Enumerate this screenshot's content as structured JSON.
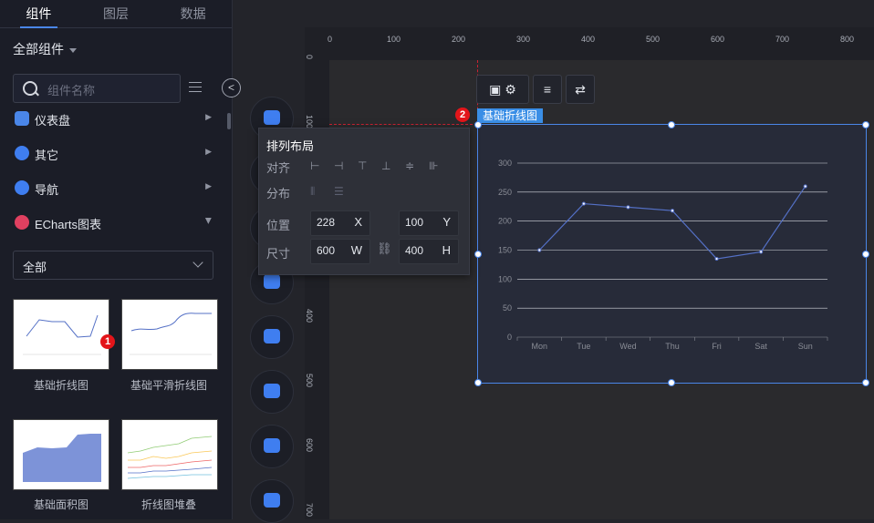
{
  "left_panel": {
    "tabs": [
      "组件",
      "图层",
      "数据"
    ],
    "all_components": "全部组件",
    "search_placeholder": "组件名称",
    "categories": [
      {
        "label": "仪表盘",
        "color": "#4a86e8"
      },
      {
        "label": "其它",
        "color": "#3f7ef0"
      },
      {
        "label": "导航",
        "color": "#3f7ef0"
      },
      {
        "label": "ECharts图表",
        "color": "#e04060"
      }
    ],
    "filter_value": "全部",
    "cards": [
      {
        "label": "基础折线图"
      },
      {
        "label": "基础平滑折线图"
      },
      {
        "label": "基础面积图"
      },
      {
        "label": "折线图堆叠"
      }
    ]
  },
  "badges": {
    "one": "1",
    "two": "2"
  },
  "rulers": {
    "h": [
      "0",
      "100",
      "200",
      "300",
      "400",
      "500",
      "600",
      "700",
      "800"
    ],
    "v": [
      "0",
      "100",
      "400",
      "500",
      "600",
      "700"
    ]
  },
  "popup": {
    "title": "排列布局",
    "align_label": "对齐",
    "distribute_label": "分布",
    "position_label": "位置",
    "size_label": "尺寸",
    "x_value": "228",
    "x_unit": "X",
    "y_value": "100",
    "y_unit": "Y",
    "w_value": "600",
    "w_unit": "W",
    "h_value": "400",
    "h_unit": "H",
    "align_icons": [
      "⊢",
      "⊣",
      "⊤",
      "⊥",
      "≑",
      "⊪"
    ],
    "distribute_icons": [
      "⦀",
      "☰"
    ]
  },
  "component_tag": "基础折线图",
  "chart_data": {
    "type": "line",
    "categories": [
      "Mon",
      "Tue",
      "Wed",
      "Thu",
      "Fri",
      "Sat",
      "Sun"
    ],
    "values": [
      150,
      230,
      224,
      218,
      135,
      147,
      260
    ],
    "ylim": [
      0,
      300
    ],
    "yticks": [
      "0",
      "50",
      "100",
      "150",
      "200",
      "250",
      "300"
    ],
    "color": "#5470c6",
    "grid": true
  }
}
